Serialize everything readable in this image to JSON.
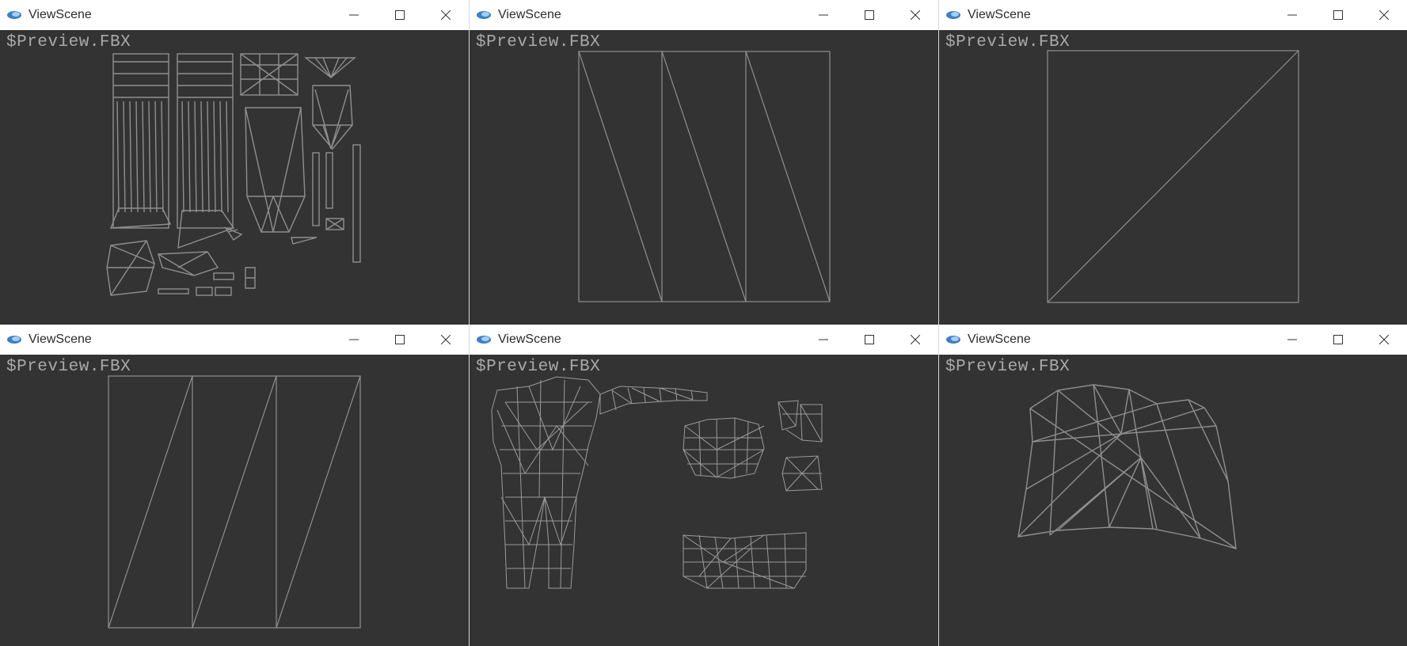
{
  "windows": [
    {
      "title": "ViewScene",
      "file_label": "$Preview.FBX"
    },
    {
      "title": "ViewScene",
      "file_label": "$Preview.FBX"
    },
    {
      "title": "ViewScene",
      "file_label": "$Preview.FBX"
    },
    {
      "title": "ViewScene",
      "file_label": "$Preview.FBX"
    },
    {
      "title": "ViewScene",
      "file_label": "$Preview.FBX"
    },
    {
      "title": "ViewScene",
      "file_label": "$Preview.FBX"
    }
  ],
  "icons": {
    "app": "viewscene-app-icon",
    "minimize": "minimize-icon",
    "maximize": "maximize-icon",
    "close": "close-icon"
  },
  "colors": {
    "viewport_bg": "#333333",
    "wireframe": "#8f8f8f",
    "label": "#a9a9a9",
    "titlebar_bg": "#ffffff"
  }
}
